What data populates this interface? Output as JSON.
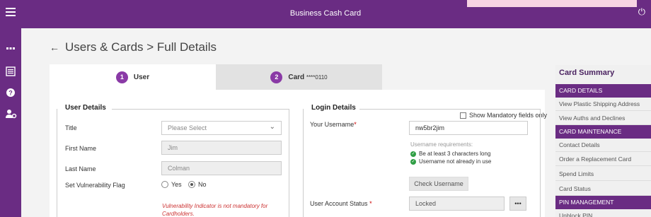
{
  "app": {
    "title": "Business Cash Card"
  },
  "page": {
    "heading": "Users & Cards > Full Details"
  },
  "tabs": [
    {
      "num": "1",
      "label": "User"
    },
    {
      "num": "2",
      "label": "Card",
      "masked": "****0110"
    }
  ],
  "options": {
    "show_mandatory_label": "Show Mandatory fields only"
  },
  "user_details": {
    "title": "User Details",
    "title_label": "Title",
    "title_value": "Please Select",
    "first_name_label": "First Name",
    "first_name_value": "Jim",
    "last_name_label": "Last Name",
    "last_name_value": "Colman",
    "vuln_label": "Set Vulnerability Flag",
    "yes_label": "Yes",
    "no_label": "No",
    "vuln_selected": "No",
    "vuln_warning_1": "Vulnerability Indicator is not mandatory for",
    "vuln_warning_2": "Cardholders."
  },
  "login_details": {
    "title": "Login Details",
    "username_label": "Your Username",
    "username_value": "nw5br2jim",
    "requirements_title": "Username requirements:",
    "requirements": [
      "Be at least 3 characters long",
      "Username not already in use"
    ],
    "check_button": "Check Username",
    "status_label": "User Account Status",
    "status_value": "Locked",
    "dots_label": "•••"
  },
  "summary": {
    "title": "Card Summary",
    "rows": [
      {
        "type": "header",
        "label": "CARD DETAILS"
      },
      {
        "type": "item",
        "label": "View Plastic Shipping Address"
      },
      {
        "type": "item",
        "label": "View Auths and Declines"
      },
      {
        "type": "header",
        "label": "CARD MAINTENANCE"
      },
      {
        "type": "item",
        "label": "Contact Details"
      },
      {
        "type": "item",
        "label": "Order a Replacement Card"
      },
      {
        "type": "item",
        "label": "Spend Limits"
      },
      {
        "type": "item",
        "label": "Card Status"
      },
      {
        "type": "header",
        "label": "PIN MANAGEMENT"
      },
      {
        "type": "item",
        "label": "Unblock PIN"
      }
    ]
  },
  "icons": {
    "menu": "hamburger-icon",
    "power": "power-icon",
    "apps": "grid-icon",
    "list": "list-icon",
    "help": "help-icon",
    "users": "user-settings-icon",
    "back": "back-arrow-icon"
  },
  "colors": {
    "brand": "#6a2c83",
    "accent": "#8a3aa6",
    "error": "#cc3333",
    "success": "#2f9e44"
  }
}
